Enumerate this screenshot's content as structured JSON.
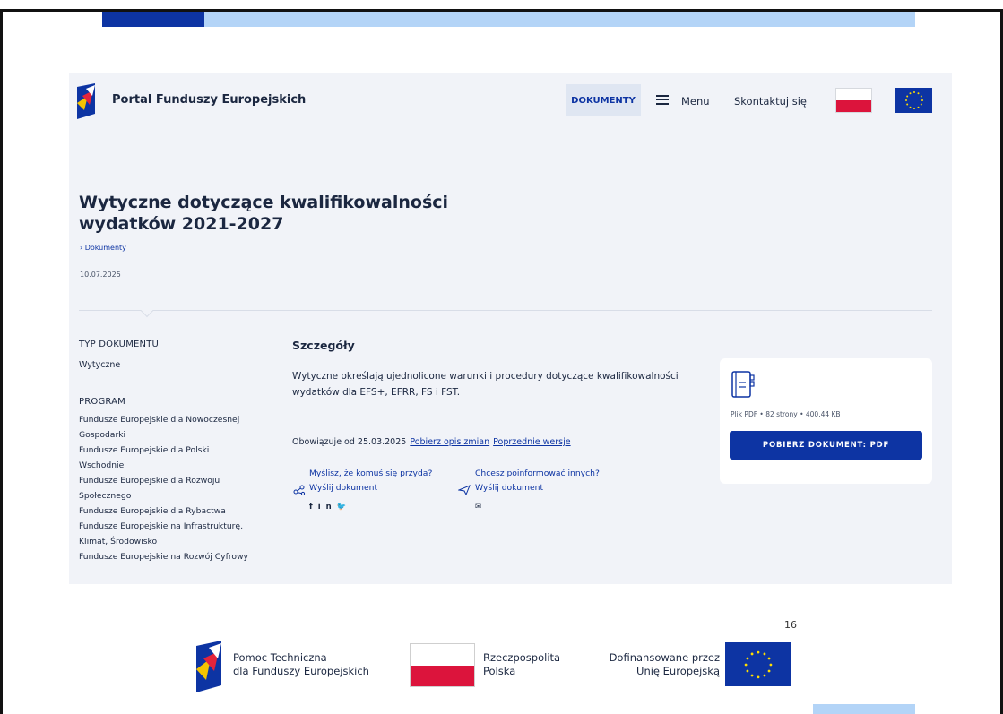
{
  "colors": {
    "accent": "#0d34a3",
    "accent_light": "#b3d4f7",
    "panel_bg": "#f1f3f8",
    "poland_red": "#dc143c"
  },
  "header": {
    "site_name": "Portal Funduszy Europejskich",
    "nav_documents": "DOKUMENTY",
    "nav_menu": "Menu",
    "nav_contact": "Skontaktuj się",
    "icons": [
      "fe-logo-icon",
      "menu-icon",
      "polish-flag-icon",
      "eu-flag-icon"
    ]
  },
  "document": {
    "title": "Wytyczne dotyczące kwalifikowalności wydatków 2021-2027",
    "breadcrumb": "› Dokumenty",
    "date": "10.07.2025"
  },
  "sidebar": {
    "type_heading": "TYP DOKUMENTU",
    "type_value": "Wytyczne",
    "program_heading": "PROGRAM",
    "programs": [
      "Fundusze Europejskie dla Nowoczesnej Gospodarki",
      "Fundusze Europejskie dla Polski Wschodniej",
      "Fundusze Europejskie dla Rozwoju Społecznego",
      "Fundusze Europejskie dla Rybactwa",
      "Fundusze Europejskie na Infrastrukturę, Klimat, Środowisko",
      "Fundusze Europejskie na Rozwój Cyfrowy"
    ]
  },
  "details": {
    "heading": "Szczegóły",
    "description": "Wytyczne określają ujednolicone warunki i procedury dotyczące kwalifikowalności wydatków dla EFS+, EFRR, FS i FST.",
    "valid_from": "Obowiązuje od 25.03.2025",
    "link_changes": "Pobierz opis zmian",
    "link_previous": "Poprzednie wersje"
  },
  "share": {
    "q1": "Myślisz, że komuś się przyda?",
    "link1": "Wyślij dokument",
    "q2": "Chcesz poinformować innych?",
    "link2": "Wyślij dokument",
    "social_icons": [
      "facebook-icon",
      "linkedin-icon",
      "twitter-icon"
    ],
    "mail_icon": "mail-icon",
    "social_glyphs": "f in",
    "mail_glyph": "✉"
  },
  "download": {
    "file_info": "Plik PDF • 82 strony • 400.44 KB",
    "button": "POBIERZ DOKUMENT: PDF",
    "icon": "document-icon"
  },
  "footer": {
    "page_number": "16",
    "logo1_line1": "Pomoc Techniczna",
    "logo1_line2": "dla Funduszy Europejskich",
    "logo2_line1": "Rzeczpospolita",
    "logo2_line2": "Polska",
    "logo3_line1": "Dofinansowane przez",
    "logo3_line2": "Unię Europejską"
  }
}
